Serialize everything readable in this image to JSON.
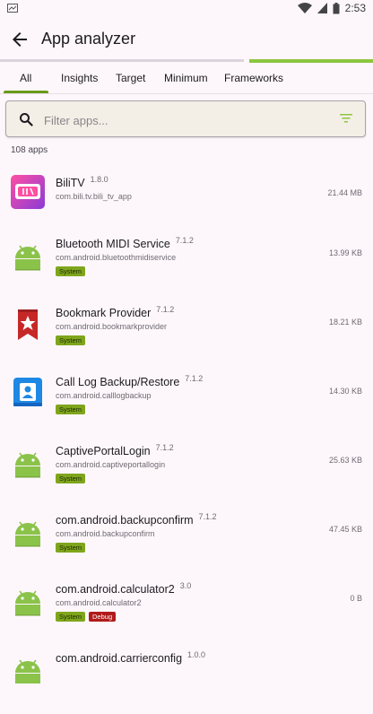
{
  "status_bar": {
    "time": "2:53"
  },
  "app_bar": {
    "title": "App analyzer"
  },
  "tabs": [
    {
      "label": "All",
      "selected": true
    },
    {
      "label": "Insights"
    },
    {
      "label": "Target"
    },
    {
      "label": "Minimum"
    },
    {
      "label": "Frameworks"
    }
  ],
  "search": {
    "placeholder": "Filter apps...",
    "value": ""
  },
  "count_label": "108 apps",
  "apps": [
    {
      "name": "BiliTV",
      "version": "1.8.0",
      "package": "com.bili.tv.bili_tv_app",
      "size": "21.44 MB",
      "badges": [],
      "icon": "bilitv-icon"
    },
    {
      "name": "Bluetooth MIDI Service",
      "version": "7.1.2",
      "package": "com.android.bluetoothmidiservice",
      "size": "13.99 KB",
      "badges": [
        "System"
      ],
      "icon": "android-icon"
    },
    {
      "name": "Bookmark Provider",
      "version": "7.1.2",
      "package": "com.android.bookmarkprovider",
      "size": "18.21 KB",
      "badges": [
        "System"
      ],
      "icon": "bookmark-icon"
    },
    {
      "name": "Call Log Backup/Restore",
      "version": "7.1.2",
      "package": "com.android.calllogbackup",
      "size": "14.30 KB",
      "badges": [
        "System"
      ],
      "icon": "contact-icon"
    },
    {
      "name": "CaptivePortalLogin",
      "version": "7.1.2",
      "package": "com.android.captiveportallogin",
      "size": "25.63 KB",
      "badges": [
        "System"
      ],
      "icon": "android-icon"
    },
    {
      "name": "com.android.backupconfirm",
      "version": "7.1.2",
      "package": "com.android.backupconfirm",
      "size": "47.45 KB",
      "badges": [
        "System"
      ],
      "icon": "android-icon"
    },
    {
      "name": "com.android.calculator2",
      "version": "3.0",
      "package": "com.android.calculator2",
      "size": "0 B",
      "badges": [
        "System",
        "Debug"
      ],
      "icon": "android-icon"
    },
    {
      "name": "com.android.carrierconfig",
      "version": "1.0.0",
      "package": "",
      "size": "",
      "badges": [],
      "icon": "android-icon"
    }
  ],
  "colors": {
    "accent": "#8cc63f",
    "system_badge": "#7fa51c",
    "debug_badge": "#b11a1a"
  }
}
